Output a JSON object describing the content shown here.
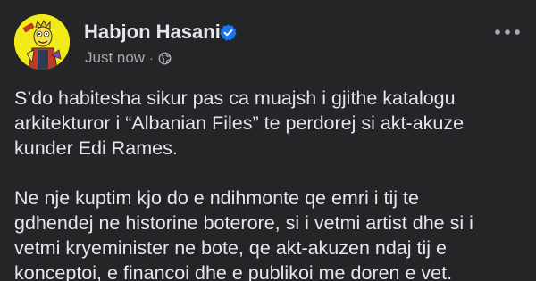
{
  "post": {
    "author": {
      "name": "Habjon Hasani",
      "verified": true,
      "avatar_icon": "cartoon-avatar-icon"
    },
    "timestamp": "Just now",
    "separator": "·",
    "audience_icon": "globe-icon",
    "more_icon": "more-options-icon",
    "paragraphs": [
      [
        "S’do habitesha sikur pas ca muajsh i gjithe katalogu",
        "arkitekturor i “Albanian Files” te perdorej si akt-akuze",
        "kunder Edi Rames."
      ],
      [
        "Ne nje kuptim kjo do e ndihmonte qe emri i tij te",
        "gdhendej ne historine boterore, si i vetmi artist dhe si i",
        "vetmi kryeminister ne bote, qe akt-akuzen ndaj tij e",
        "konceptoi, e financoi dhe e publikoi me doren e vet."
      ]
    ]
  },
  "colors": {
    "background": "#242526",
    "text_primary": "#e4e6eb",
    "text_secondary": "#a8abaf",
    "verified_badge": "#1877f2",
    "avatar_bg": "#f3ea1a"
  }
}
